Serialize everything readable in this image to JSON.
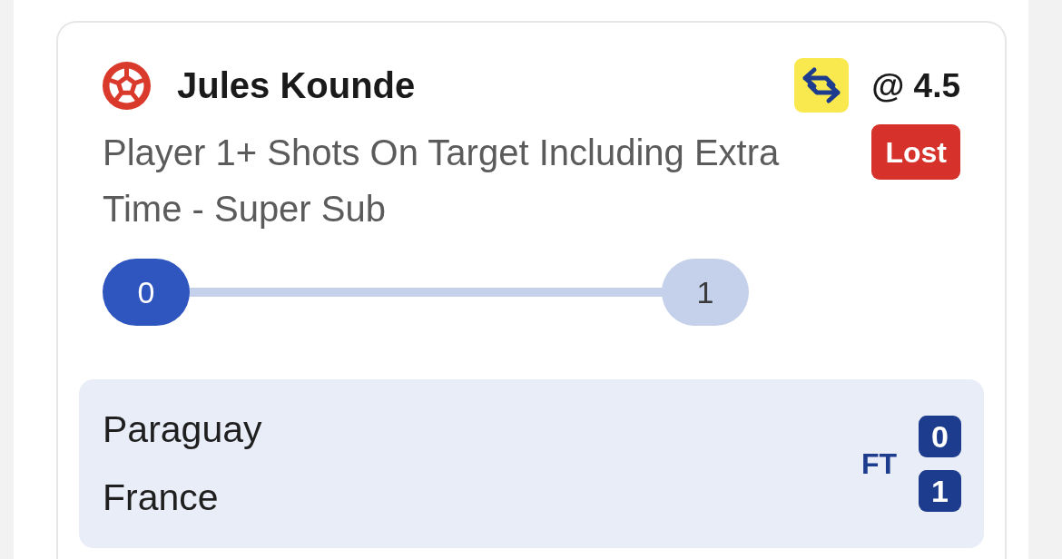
{
  "selection": {
    "player": "Jules Kounde",
    "odds": "@ 4.5",
    "market": "Player 1+ Shots On Target Including Extra Time - Super Sub",
    "status": {
      "label": "Lost",
      "kind": "lost"
    }
  },
  "progress": {
    "current": "0",
    "target": "1",
    "level": 0
  },
  "event": {
    "teams": [
      {
        "name": "Paraguay",
        "score": "0"
      },
      {
        "name": "France",
        "score": "1"
      }
    ],
    "status": "FT"
  }
}
